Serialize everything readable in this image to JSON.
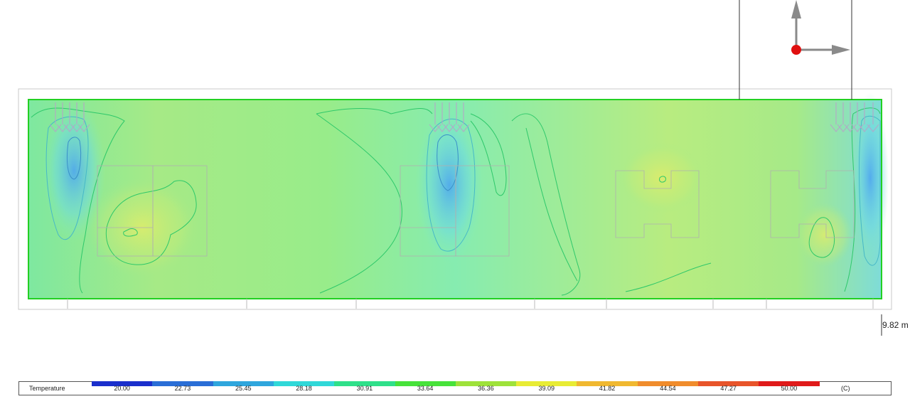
{
  "legend": {
    "title": "Temperature",
    "unit": "(C)",
    "ticks": [
      "20.00",
      "22.73",
      "25.45",
      "28.18",
      "30.91",
      "33.64",
      "36.36",
      "39.09",
      "41.82",
      "44.54",
      "47.27",
      "50.00"
    ],
    "colors": [
      "#1a2fcc",
      "#2a6ed6",
      "#2fa6dd",
      "#30d8d8",
      "#2fe08a",
      "#47e23a",
      "#9ee23a",
      "#e8ec34",
      "#f0b830",
      "#f08c2c",
      "#e8542a",
      "#e01a1a"
    ]
  },
  "scale": {
    "label": "9.82 m"
  },
  "axes_icon": {
    "origin_color": "#e01010",
    "arrow_color": "#8a8a8a"
  },
  "domain_outline_color": "#22d022"
}
